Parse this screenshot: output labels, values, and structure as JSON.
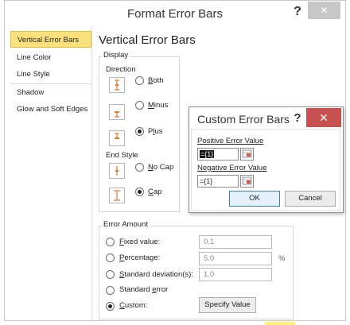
{
  "window": {
    "title": "Format Error Bars",
    "help_glyph": "?",
    "close_glyph": "✕"
  },
  "nav": {
    "items": [
      {
        "label": "Vertical Error Bars",
        "selected": true
      },
      {
        "label": "Line Color"
      },
      {
        "label": "Line Style"
      },
      {
        "label": "Shadow"
      },
      {
        "label": "Glow and Soft Edges"
      }
    ]
  },
  "panel": {
    "title": "Vertical Error Bars"
  },
  "display": {
    "group_label": "Display",
    "direction_label": "Direction",
    "direction_options": [
      {
        "label": "Both",
        "accel": "B",
        "selected": false,
        "icon": "both-direction-icon"
      },
      {
        "label": "Minus",
        "accel": "M",
        "selected": false,
        "icon": "minus-direction-icon"
      },
      {
        "label": "Plus",
        "accel": "l",
        "selected": true,
        "icon": "plus-direction-icon"
      }
    ],
    "end_style_label": "End Style",
    "end_style_options": [
      {
        "label": "No Cap",
        "accel": "N",
        "selected": false,
        "icon": "no-cap-icon"
      },
      {
        "label": "Cap",
        "accel": "C",
        "selected": true,
        "icon": "cap-icon"
      }
    ]
  },
  "error_amount": {
    "group_label": "Error Amount",
    "options": [
      {
        "label": "Fixed value:",
        "accel": "F",
        "selected": false,
        "value": "0.1"
      },
      {
        "label": "Percentage:",
        "accel": "P",
        "selected": false,
        "value": "5.0",
        "unit": "%"
      },
      {
        "label": "Standard deviation(s):",
        "accel": "S",
        "selected": false,
        "value": "1.0"
      },
      {
        "label": "Standard error",
        "accel": "e",
        "selected": false
      },
      {
        "label": "Custom:",
        "accel": "C",
        "selected": true
      }
    ],
    "specify_button": "Specify Value"
  },
  "custom_dialog": {
    "title": "Custom Error Bars",
    "help_glyph": "?",
    "close_glyph": "✕",
    "positive_label": "Positive Error Value",
    "positive_value": "={1}",
    "negative_label": "Negative Error Value",
    "negative_value": "={1}",
    "ok_label": "OK",
    "cancel_label": "Cancel"
  },
  "colors": {
    "close_red": "#c75050",
    "nav_selected": "#fbe07e",
    "accent_border": "#3c7fb1"
  }
}
